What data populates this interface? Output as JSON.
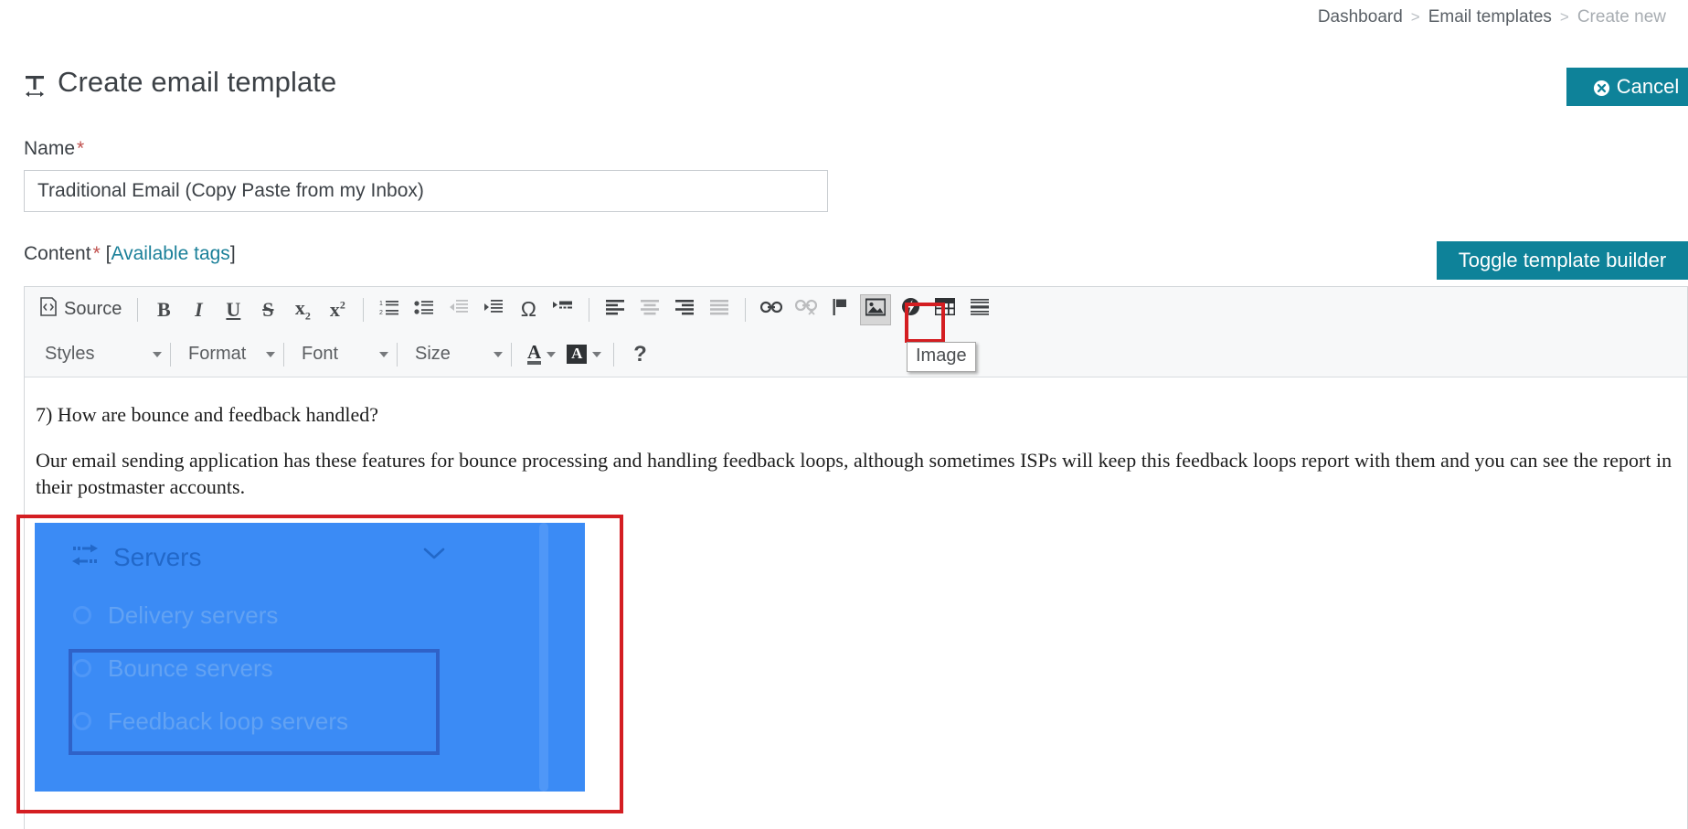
{
  "breadcrumb": {
    "items": [
      {
        "label": "Dashboard",
        "current": false
      },
      {
        "label": "Email templates",
        "current": false
      },
      {
        "label": "Create new",
        "current": true
      }
    ],
    "separator": ">"
  },
  "header": {
    "title": "Create email template",
    "title_icon": "text-width-icon",
    "cancel_label": "Cancel",
    "cancel_icon": "circle-x-icon",
    "accent_color": "#0e8299"
  },
  "form": {
    "name_label": "Name",
    "required_mark": "*",
    "name_value": "Traditional Email (Copy Paste from my Inbox)",
    "content_label": "Content",
    "available_tags_open": "[",
    "available_tags_label": "Available tags",
    "available_tags_close": "]",
    "toggle_builder_label": "Toggle template builder",
    "link_color": "#1b8099",
    "required_color": "#c0504d"
  },
  "toolbar": {
    "source_label": "Source",
    "source_icon": "source-code-icon",
    "row1": [
      {
        "name": "bold",
        "glyph": "B",
        "state": "normal"
      },
      {
        "name": "italic",
        "glyph": "I",
        "state": "normal"
      },
      {
        "name": "underline",
        "glyph": "U",
        "state": "normal"
      },
      {
        "name": "strikethrough",
        "glyph": "S",
        "state": "normal"
      },
      {
        "name": "subscript",
        "glyph": "x",
        "state": "normal"
      },
      {
        "name": "superscript",
        "glyph": "x",
        "state": "normal"
      },
      {
        "name": "numbered-list",
        "glyph": "",
        "state": "normal"
      },
      {
        "name": "bulleted-list",
        "glyph": "",
        "state": "normal"
      },
      {
        "name": "decrease-indent",
        "glyph": "",
        "state": "disabled"
      },
      {
        "name": "increase-indent",
        "glyph": "",
        "state": "normal"
      },
      {
        "name": "special-character",
        "glyph": "Ω",
        "state": "normal"
      },
      {
        "name": "blockquote",
        "glyph": "",
        "state": "normal"
      },
      {
        "name": "align-left",
        "glyph": "",
        "state": "normal"
      },
      {
        "name": "align-center",
        "glyph": "",
        "state": "disabled"
      },
      {
        "name": "align-right",
        "glyph": "",
        "state": "normal"
      },
      {
        "name": "justify",
        "glyph": "",
        "state": "disabled"
      },
      {
        "name": "link",
        "glyph": "",
        "state": "normal"
      },
      {
        "name": "unlink",
        "glyph": "",
        "state": "disabled"
      },
      {
        "name": "anchor",
        "glyph": "",
        "state": "normal"
      },
      {
        "name": "image",
        "glyph": "",
        "state": "active"
      },
      {
        "name": "flash",
        "glyph": "",
        "state": "normal"
      },
      {
        "name": "table",
        "glyph": "",
        "state": "normal"
      },
      {
        "name": "horizontal-rule",
        "glyph": "",
        "state": "normal"
      }
    ],
    "selects": [
      {
        "name": "styles",
        "label": "Styles"
      },
      {
        "name": "format",
        "label": "Format"
      },
      {
        "name": "font",
        "label": "Font"
      },
      {
        "name": "size",
        "label": "Size"
      }
    ],
    "text_color_label": "A",
    "bg_color_label": "A",
    "help_label": "?",
    "tooltip": "Image",
    "highlight_color": "#d41e22"
  },
  "editor": {
    "heading": "7) How are bounce and feedback handled?",
    "paragraph": "Our email sending application has these features for bounce processing and handling feedback loops, although sometimes ISPs will keep this feedback loops report with them and you can see the report in their postmaster accounts.",
    "embedded_image": {
      "menu_title": "Servers",
      "menu_icon": "exchange-arrows-icon",
      "chevron_icon": "chevron-down-icon",
      "bullet_icon": "circle-icon",
      "items": [
        {
          "label": "Delivery servers",
          "highlighted": false
        },
        {
          "label": "Bounce servers",
          "highlighted": true
        },
        {
          "label": "Feedback loop servers",
          "highlighted": true
        }
      ],
      "background_color": "#3b8bf5",
      "title_color": "#2268c9",
      "item_color": "#62a2f3",
      "inner_box_color": "#2f62c8",
      "annotation_color": "#d41e22"
    }
  }
}
